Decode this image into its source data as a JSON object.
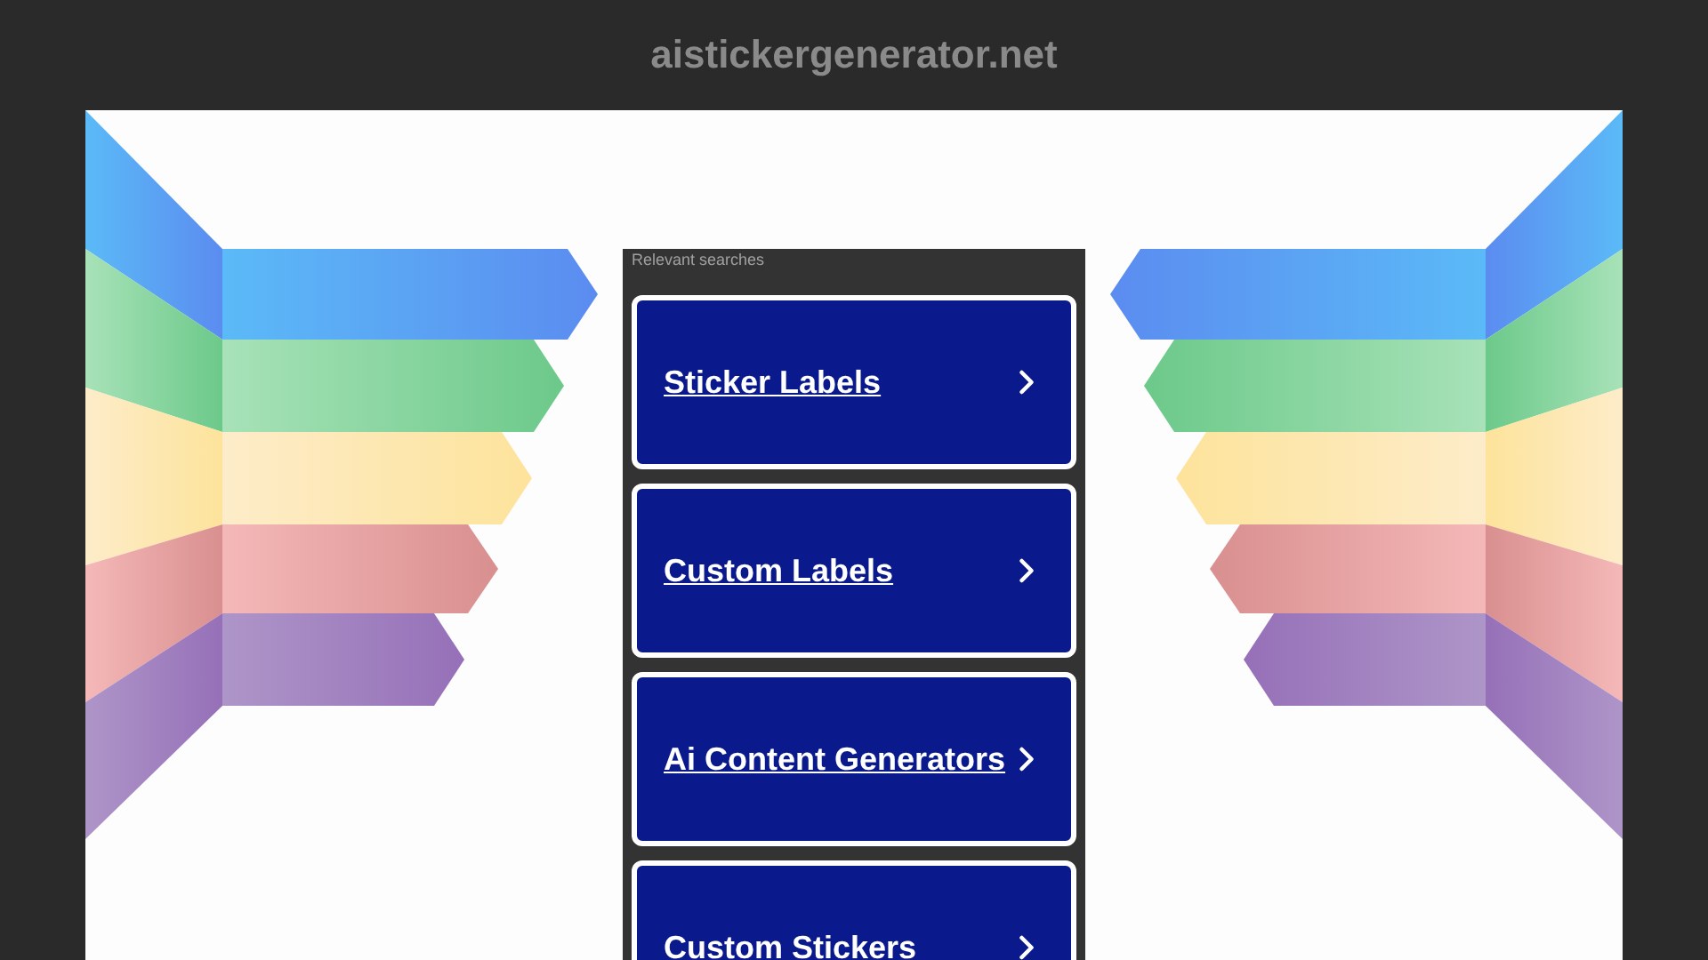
{
  "site_title": "aistickergenerator.net",
  "related": {
    "heading": "Relevant searches",
    "links": [
      {
        "label": "Sticker Labels"
      },
      {
        "label": "Custom Labels"
      },
      {
        "label": "Ai Content Generators"
      },
      {
        "label": "Custom Stickers"
      }
    ]
  }
}
